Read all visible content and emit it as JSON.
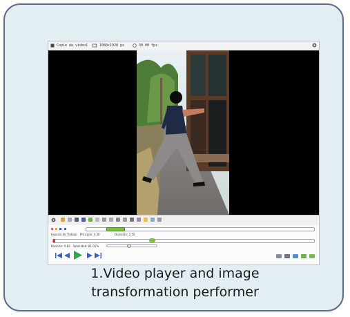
{
  "window": {
    "title": "Copie de video1",
    "resolution": "1080×1920 px",
    "fps": "30.00 fps"
  },
  "controls": {
    "workspace_label": "Espacio de Trabajo",
    "start_label": "Principio: 4.30",
    "duration_label": "Duración: 2.55",
    "position_label": "Posición: 0.83",
    "speed_label": "Velocidad: 81.01%",
    "workspace_range": "4.30 - 6.85",
    "current_marker": "0.83"
  },
  "caption": {
    "line1": "1.Video player and image",
    "line2": "transformation performer"
  },
  "colors": {
    "card_bg": "#e3eef3",
    "card_border": "#5d6a8a",
    "play_green": "#2aa84a",
    "nav_blue": "#3a62b8",
    "range_green": "#7ac143"
  },
  "icons": [
    "app-icon",
    "resolution-icon",
    "fps-icon",
    "settings-icon",
    "play-icon",
    "skip-back-icon",
    "step-back-icon",
    "step-forward-icon",
    "skip-forward-icon"
  ]
}
